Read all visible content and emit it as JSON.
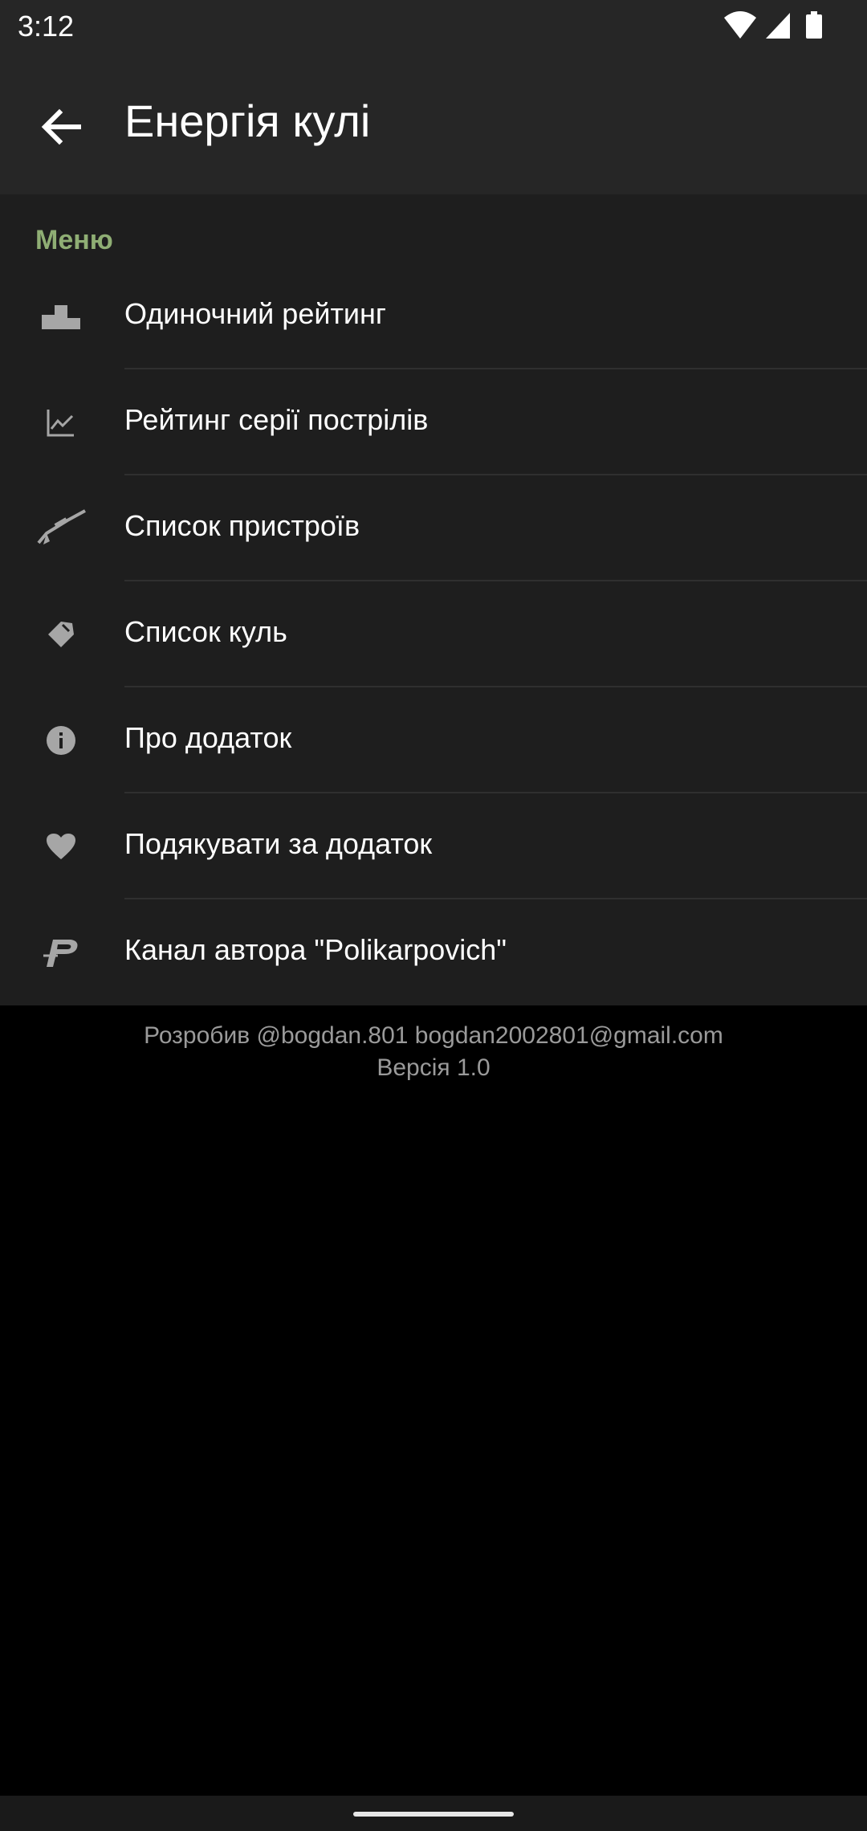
{
  "status": {
    "time": "3:12"
  },
  "appbar": {
    "title": "Енергія кулі",
    "back_icon": "arrow-back-icon"
  },
  "menu": {
    "header": "Меню",
    "items": [
      {
        "label": "Одиночний рейтинг",
        "icon": "podium-icon"
      },
      {
        "label": "Рейтинг серії пострілів",
        "icon": "chart-line-icon"
      },
      {
        "label": "Список пристроїв",
        "icon": "rifle-icon"
      },
      {
        "label": "Список куль",
        "icon": "bullet-icon"
      },
      {
        "label": "Про додаток",
        "icon": "info-icon"
      },
      {
        "label": "Подякувати за додаток",
        "icon": "heart-icon"
      },
      {
        "label": "Канал автора \"Polikarpovich\"",
        "icon": "p-logo-icon"
      }
    ]
  },
  "footer": {
    "line1": "Розробив @bogdan.801 bogdan2002801@gmail.com",
    "line2": "Версія 1.0"
  },
  "colors": {
    "accent": "#8fae74",
    "bar": "#262626",
    "panel": "#1e1e1e"
  }
}
